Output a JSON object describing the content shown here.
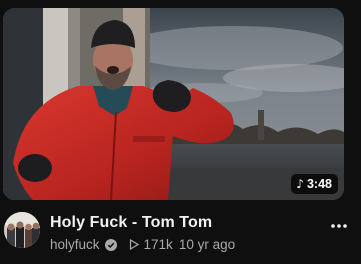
{
  "video": {
    "title": "Holy Fuck - Tom Tom",
    "duration": "3:48",
    "duration_icon": "music-note-icon"
  },
  "channel": {
    "name": "holyfuck",
    "verified_icon": "verified-icon",
    "views": "171k",
    "age": "10 yr ago"
  },
  "actions": {
    "more_icon": "more-vert-icon"
  },
  "colors": {
    "background": "#0f0f0f",
    "title": "#f1f1f1",
    "secondary": "#aaaaaa",
    "jacket": "#c9302a"
  }
}
